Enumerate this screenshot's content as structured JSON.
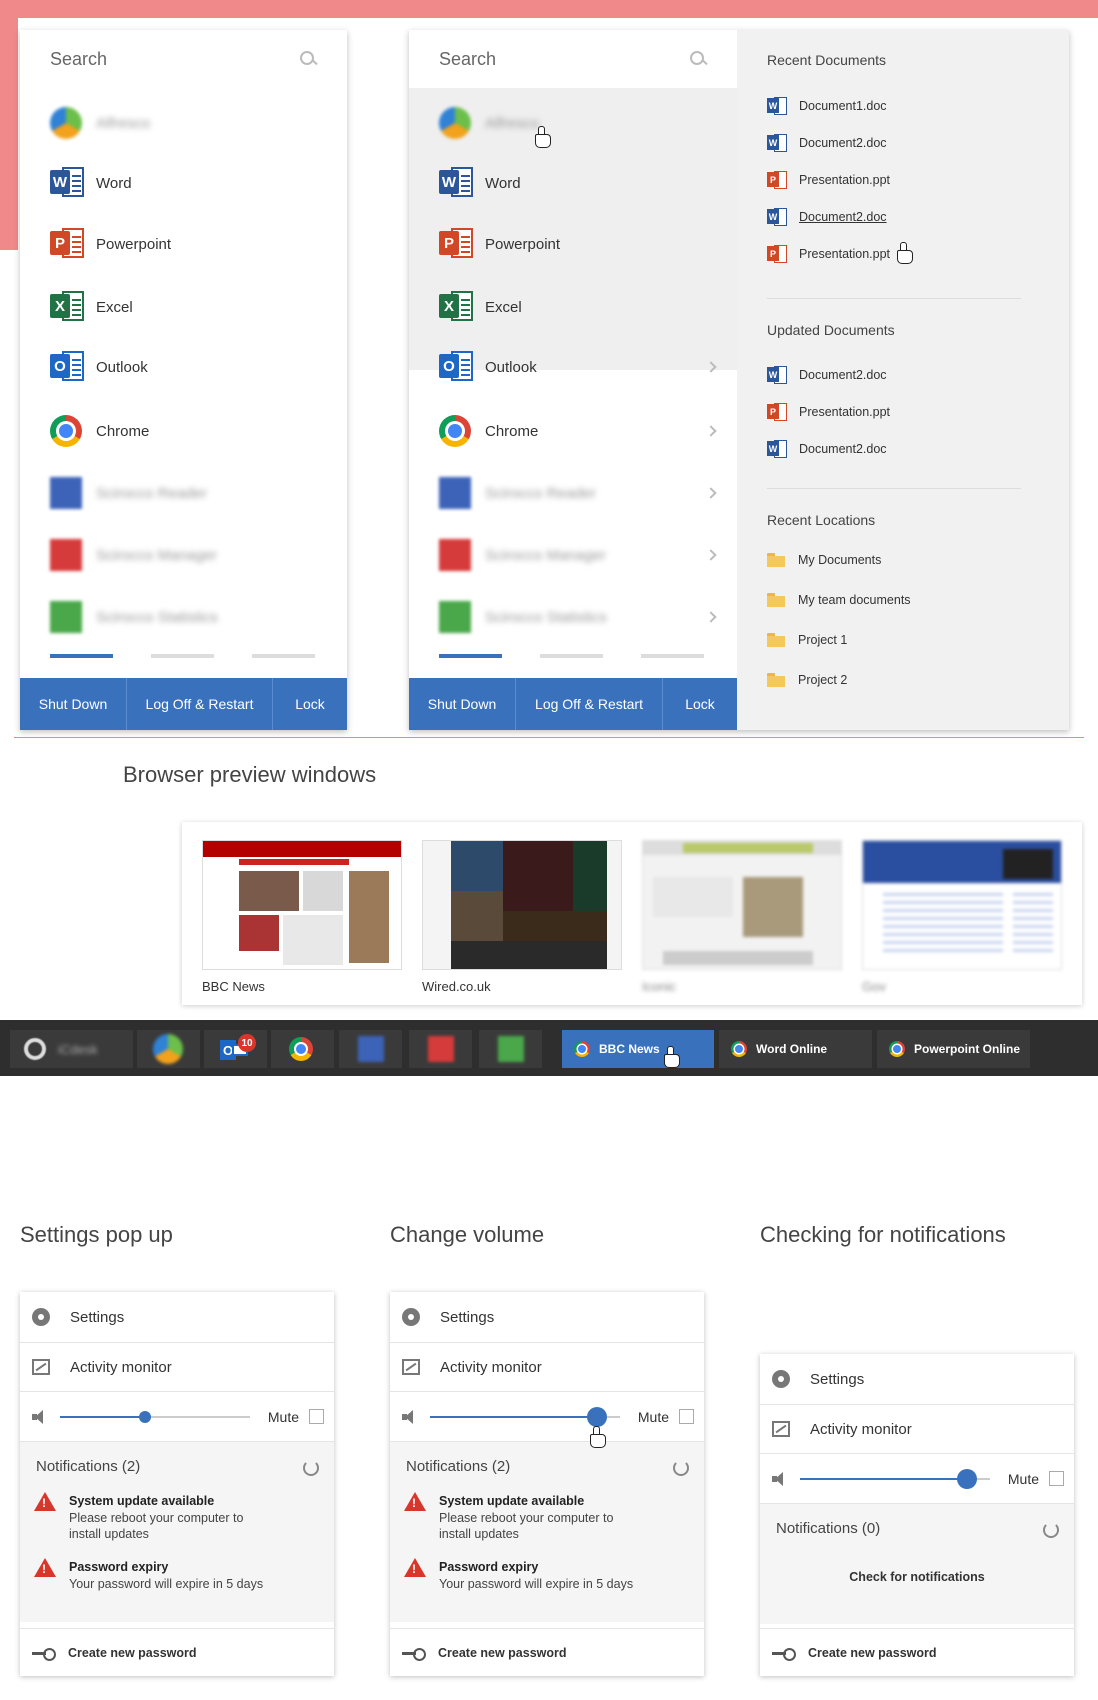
{
  "start_menu": {
    "search_placeholder": "Search",
    "apps": [
      {
        "label": "Alfresco",
        "icon": "alfresco-icon",
        "blurred": true
      },
      {
        "label": "Word",
        "icon": "word-icon"
      },
      {
        "label": "Powerpoint",
        "icon": "powerpoint-icon"
      },
      {
        "label": "Excel",
        "icon": "excel-icon"
      },
      {
        "label": "Outlook",
        "icon": "outlook-icon"
      },
      {
        "label": "Chrome",
        "icon": "chrome-icon"
      },
      {
        "label": "Scirocco Reader",
        "icon": "scirocco-reader-icon",
        "blurred": true
      },
      {
        "label": "Scirocco Manager",
        "icon": "scirocco-manager-icon",
        "blurred": true
      },
      {
        "label": "Scirocco Statistics",
        "icon": "scirocco-statistics-icon",
        "blurred": true
      }
    ],
    "footer": {
      "shutdown": "Shut Down",
      "logoff": "Log Off & Restart",
      "lock": "Lock"
    }
  },
  "recent_panel": {
    "recent_documents_title": "Recent Documents",
    "recent_documents": [
      {
        "label": "Document1.doc",
        "type": "word"
      },
      {
        "label": "Document2.doc",
        "type": "word"
      },
      {
        "label": "Presentation.ppt",
        "type": "powerpoint"
      },
      {
        "label": "Document2.doc",
        "type": "word"
      },
      {
        "label": "Presentation.ppt",
        "type": "powerpoint"
      }
    ],
    "updated_documents_title": "Updated Documents",
    "updated_documents": [
      {
        "label": "Document2.doc",
        "type": "word"
      },
      {
        "label": "Presentation.ppt",
        "type": "powerpoint"
      },
      {
        "label": "Document2.doc",
        "type": "word"
      }
    ],
    "recent_locations_title": "Recent Locations",
    "recent_locations": [
      "My Documents",
      "My team documents",
      "Project 1",
      "Project 2"
    ]
  },
  "browser_preview": {
    "title": "Browser preview windows",
    "thumbs": [
      "BBC News",
      "Wired.co.uk",
      "Iconic",
      "Gov"
    ]
  },
  "taskbar": {
    "start_label": "iCdesk",
    "outlook_badge": "10",
    "tabs": [
      "BBC News",
      "Word Online",
      "Powerpoint Online"
    ]
  },
  "settings_cards": [
    {
      "title": "Settings pop up",
      "settings": "Settings",
      "activity": "Activity  monitor",
      "volume": 0.45,
      "mute": "Mute",
      "notifications_title": "Notifications (2)",
      "notifications": [
        {
          "title": "System update available",
          "text1": "Please reboot your computer to",
          "text2": "install updates"
        },
        {
          "title": "Password expiry",
          "text1": "Your password will expire in 5 days",
          "text2": ""
        }
      ],
      "footer": "Create new password"
    },
    {
      "title": "Change volume",
      "settings": "Settings",
      "activity": "Activity monitor",
      "volume": 0.88,
      "mute": "Mute",
      "notifications_title": "Notifications (2)",
      "notifications": [
        {
          "title": "System update available",
          "text1": "Please reboot your computer to",
          "text2": "install updates"
        },
        {
          "title": "Password expiry",
          "text1": "Your password will expire in 5 days",
          "text2": ""
        }
      ],
      "footer": "Create new password"
    },
    {
      "title": "Checking for notifications",
      "settings": "Settings",
      "activity": "Activity monitor",
      "volume": 0.88,
      "mute": "Mute",
      "notifications_title": "Notifications (0)",
      "check": "Check for notifications",
      "footer": "Create new password"
    }
  ],
  "colors": {
    "accent": "#3a71bd",
    "pink": "#f08a8a",
    "taskbar": "#2e2e2e",
    "warning": "#d9362b"
  }
}
